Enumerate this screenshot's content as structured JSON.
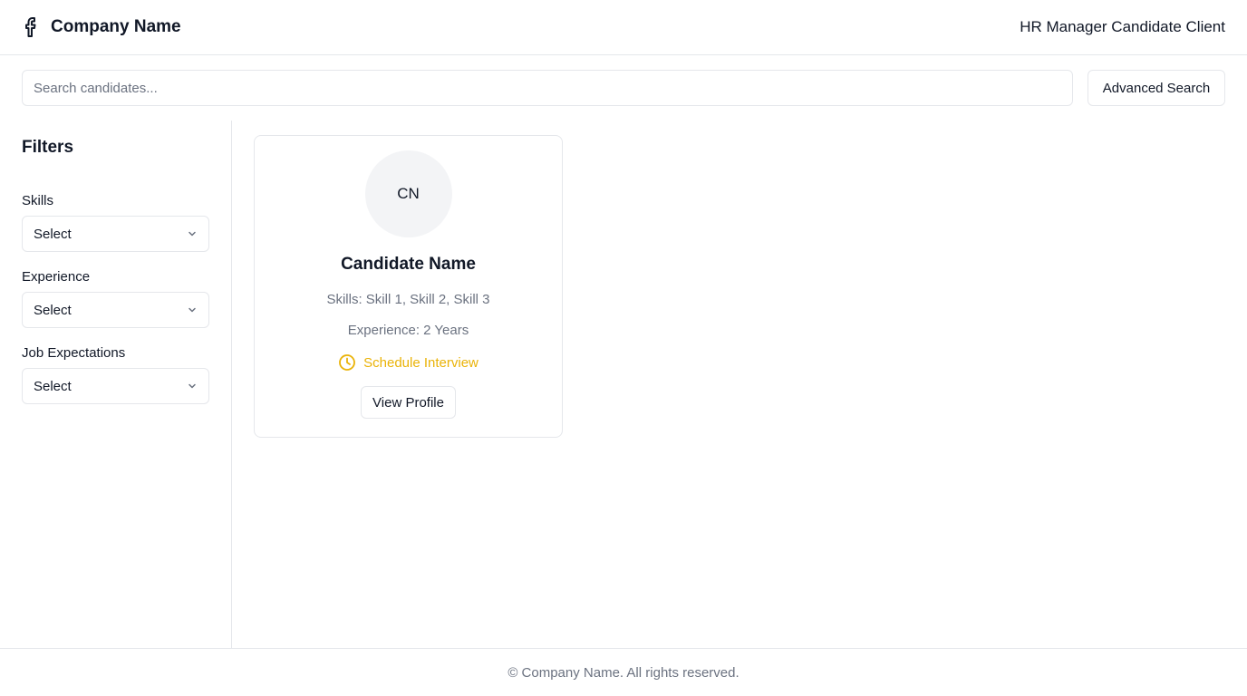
{
  "header": {
    "company_name": "Company Name",
    "logo_icon": "facebook-f-icon",
    "app_title": "HR Manager Candidate Client"
  },
  "search": {
    "placeholder": "Search candidates...",
    "value": "",
    "advanced_label": "Advanced Search"
  },
  "sidebar": {
    "title": "Filters",
    "filters": [
      {
        "label": "Skills",
        "value": "Select"
      },
      {
        "label": "Experience",
        "value": "Select"
      },
      {
        "label": "Job Expectations",
        "value": "Select"
      }
    ]
  },
  "candidates": [
    {
      "initials": "CN",
      "name": "Candidate Name",
      "skills": "Skills: Skill 1, Skill 2, Skill 3",
      "experience": "Experience: 2 Years",
      "schedule_label": "Schedule Interview",
      "view_label": "View Profile"
    }
  ],
  "footer": {
    "text": "© Company Name. All rights reserved."
  },
  "colors": {
    "accent": "#eab308",
    "border": "#e5e7eb",
    "muted_text": "#6b7280",
    "avatar_bg": "#f3f4f6"
  }
}
